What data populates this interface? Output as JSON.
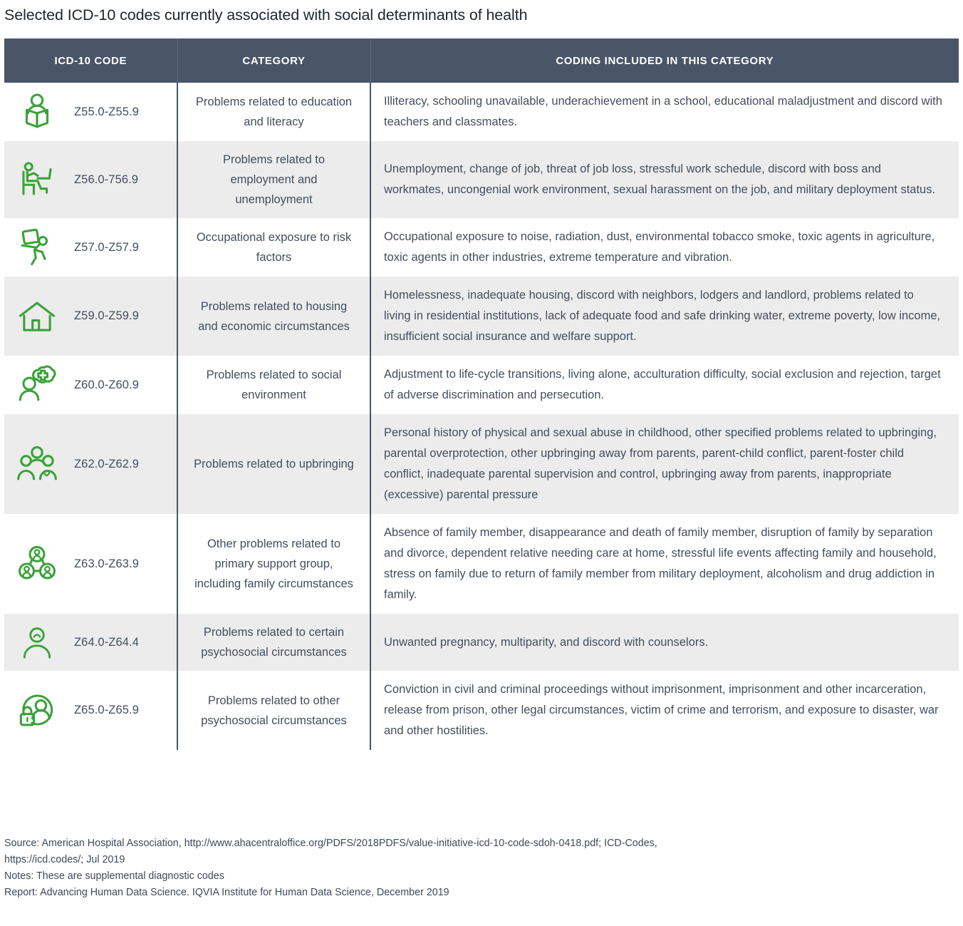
{
  "title": "Selected ICD-10 codes currently associated with social determinants of health",
  "colors": {
    "header_bg": "#4a5568",
    "icon_green": "#3aa239",
    "text": "#434e5e",
    "alt_row": "#ececec"
  },
  "table": {
    "headers": {
      "code": "ICD-10 CODE",
      "category": "CATEGORY",
      "description": "CODING INCLUDED IN THIS CATEGORY"
    },
    "rows": [
      {
        "icon": "person-reading-book-icon",
        "code": "Z55.0-Z55.9",
        "category": "Problems related to education and literacy",
        "description": "Illiteracy, schooling unavailable, underachievement in a school, educational maladjustment and discord with teachers and classmates."
      },
      {
        "icon": "person-at-desk-icon",
        "code": "Z56.0-756.9",
        "category": "Problems related to employment and unemployment",
        "description": "Unemployment, change of job, threat of job loss, stressful work schedule, discord with boss and workmates, uncongenial work environment, sexual harassment on the job, and military deployment status."
      },
      {
        "icon": "worker-carrying-load-icon",
        "code": "Z57.0-Z57.9",
        "category": "Occupational exposure to risk factors",
        "description": "Occupational exposure to noise, radiation, dust, environmental tobacco smoke, toxic agents in agriculture, toxic agents in other industries, extreme temperature and vibration."
      },
      {
        "icon": "house-icon",
        "code": "Z59.0-Z59.9",
        "category": "Problems related to housing and economic circumstances",
        "description": "Homelessness, inadequate housing, discord with neighbors, lodgers and landlord, problems related to living in residential institutions, lack of adequate food and safe drinking water, extreme poverty, low income, insufficient social insurance and welfare support."
      },
      {
        "icon": "person-thought-bubble-health-icon",
        "code": "Z60.0-Z60.9",
        "category": "Problems related to social environment",
        "description": "Adjustment to life-cycle transitions, living alone, acculturation difficulty, social exclusion and rejection, target of adverse discrimination and persecution."
      },
      {
        "icon": "family-heart-icon",
        "code": "Z62.0-Z62.9",
        "category": "Problems related to upbringing",
        "description": "Personal history of physical and sexual abuse in childhood, other specified problems related to upbringing, parental overprotection, other upbringing away from parents, parent-child conflict, parent-foster child conflict, inadequate parental supervision and control, upbringing away from parents, inappropriate (excessive) parental pressure"
      },
      {
        "icon": "people-network-icon",
        "code": "Z63.0-Z63.9",
        "category": "Other problems related to primary support group, including family circumstances",
        "description": "Absence of family member, disappearance and death of family member, disruption of family by separation and divorce, dependent relative needing care at home, stressful life events affecting family and household, stress on family due to return of family member from military deployment, alcoholism and drug addiction in family."
      },
      {
        "icon": "sad-person-icon",
        "code": "Z64.0-Z64.4",
        "category": "Problems related to certain psychosocial circumstances",
        "description": "Unwanted pregnancy, multiparity, and discord with counselors."
      },
      {
        "icon": "person-lock-icon",
        "code": "Z65.0-Z65.9",
        "category": "Problems related to other psychosocial circumstances",
        "description": "Conviction in civil and criminal proceedings without imprisonment, imprisonment and other incarceration, release from prison, other legal circumstances, victim of crime and terrorism, and exposure to disaster, war and other hostilities."
      }
    ]
  },
  "footer": {
    "source_line1": "Source: American Hospital Association, http://www.ahacentraloffice.org/PDFS/2018PDFS/value-initiative-icd-10-code-sdoh-0418.pdf; ICD-Codes,",
    "source_line2": "https://icd.codes/;  Jul 2019",
    "notes": "Notes: These are supplemental diagnostic codes",
    "report": "Report: Advancing Human Data Science. IQVIA Institute for Human Data Science, December 2019"
  }
}
